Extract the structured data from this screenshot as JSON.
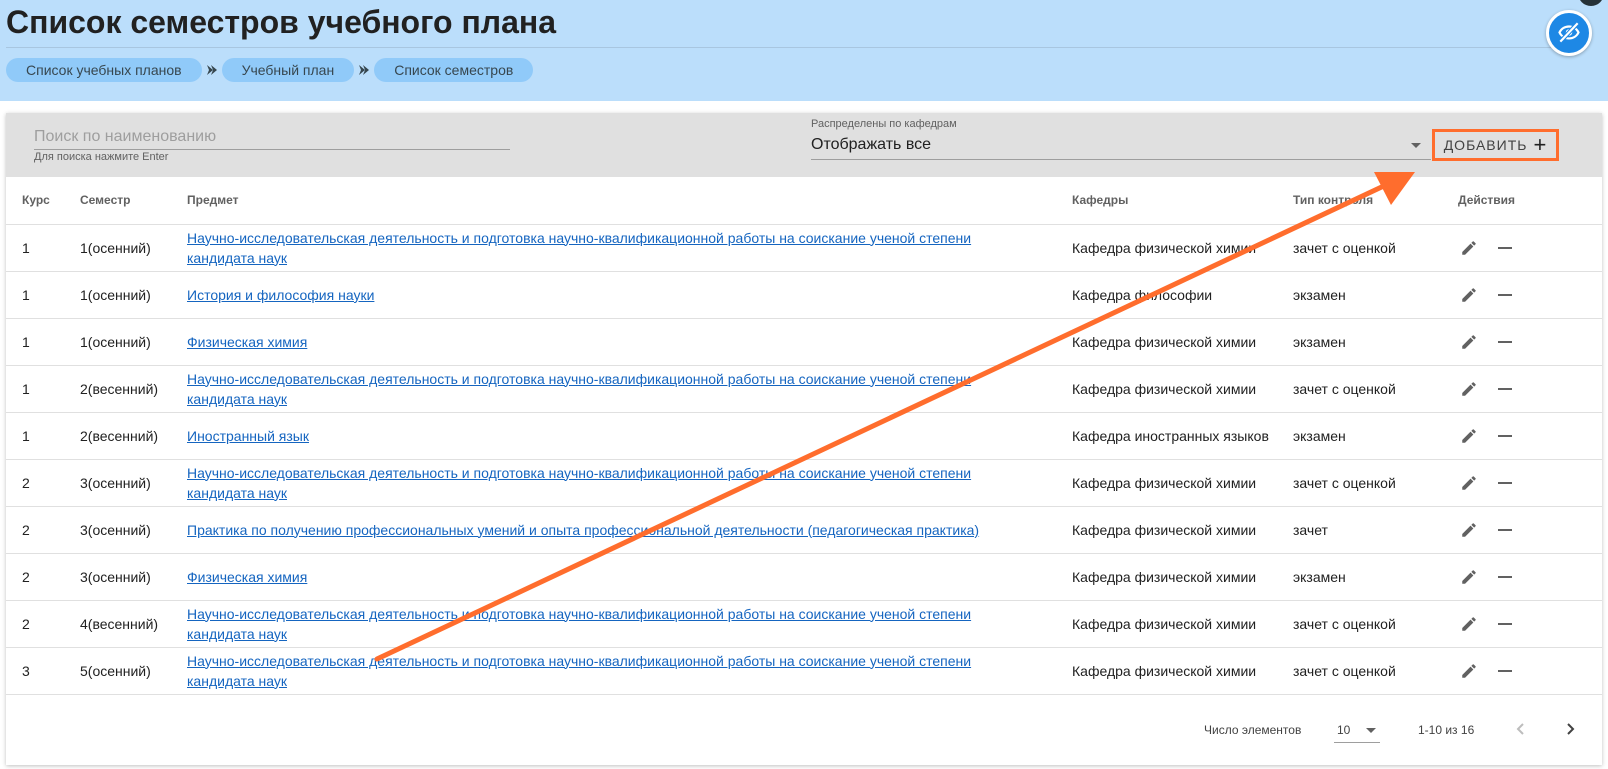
{
  "page_title": "Список семестров учебного плана",
  "breadcrumb": [
    "Список учебных планов",
    "Учебный план",
    "Список семестров"
  ],
  "search": {
    "placeholder": "Поиск по наименованию",
    "hint": "Для поиска нажмите Enter"
  },
  "filter": {
    "label": "Распределены по кафедрам",
    "value": "Отображать все"
  },
  "add_button_label": "ДОБАВИТЬ",
  "table": {
    "headers": {
      "course": "Курс",
      "semester": "Семестр",
      "subject": "Предмет",
      "department": "Кафедры",
      "control": "Тип контроля",
      "actions": "Действия"
    },
    "rows": [
      {
        "course": "1",
        "semester": "1(осенний)",
        "subject": "Научно-исследовательская деятельность и подготовка научно-квалификационной работы на соискание ученой степени кандидата наук",
        "department": "Кафедра физической химии",
        "control": "зачет с оценкой"
      },
      {
        "course": "1",
        "semester": "1(осенний)",
        "subject": "История и философия науки",
        "department": "Кафедра философии",
        "control": "экзамен"
      },
      {
        "course": "1",
        "semester": "1(осенний)",
        "subject": "Физическая химия",
        "department": "Кафедра физической химии",
        "control": "экзамен"
      },
      {
        "course": "1",
        "semester": "2(весенний)",
        "subject": "Научно-исследовательская деятельность и подготовка научно-квалификационной работы на соискание ученой степени кандидата наук",
        "department": "Кафедра физической химии",
        "control": "зачет с оценкой"
      },
      {
        "course": "1",
        "semester": "2(весенний)",
        "subject": "Иностранный язык",
        "department": "Кафедра иностранных языков",
        "control": "экзамен"
      },
      {
        "course": "2",
        "semester": "3(осенний)",
        "subject": "Научно-исследовательская деятельность и подготовка научно-квалификационной работы на соискание ученой степени кандидата наук",
        "department": "Кафедра физической химии",
        "control": "зачет с оценкой"
      },
      {
        "course": "2",
        "semester": "3(осенний)",
        "subject": "Практика по получению профессиональных умений и опыта профессиональной деятельности (педагогическая практика)",
        "department": "Кафедра физической химии",
        "control": "зачет"
      },
      {
        "course": "2",
        "semester": "3(осенний)",
        "subject": "Физическая химия",
        "department": "Кафедра физической химии",
        "control": "экзамен"
      },
      {
        "course": "2",
        "semester": "4(весенний)",
        "subject": "Научно-исследовательская деятельность и подготовка научно-квалификационной работы на соискание ученой степени кандидата наук",
        "department": "Кафедра физической химии",
        "control": "зачет с оценкой"
      },
      {
        "course": "3",
        "semester": "5(осенний)",
        "subject": "Научно-исследовательская деятельность и подготовка научно-квалификационной работы на соискание ученой степени кандидата наук",
        "department": "Кафедра физической химии",
        "control": "зачет с оценкой"
      }
    ]
  },
  "pagination": {
    "label": "Число элементов",
    "per_page": "10",
    "range": "1-10 из 16"
  },
  "icons": {
    "edit": "pencil-icon",
    "remove": "minus-icon",
    "visibility": "eye-off-icon",
    "prev": "chevron-left-icon",
    "next": "chevron-right-icon"
  },
  "colors": {
    "header_bg": "#bbdefb",
    "crumb_bg": "#90caf9",
    "link": "#1565c0",
    "annotation": "#ff6d2d",
    "visibility_button": "#1e88e5"
  }
}
